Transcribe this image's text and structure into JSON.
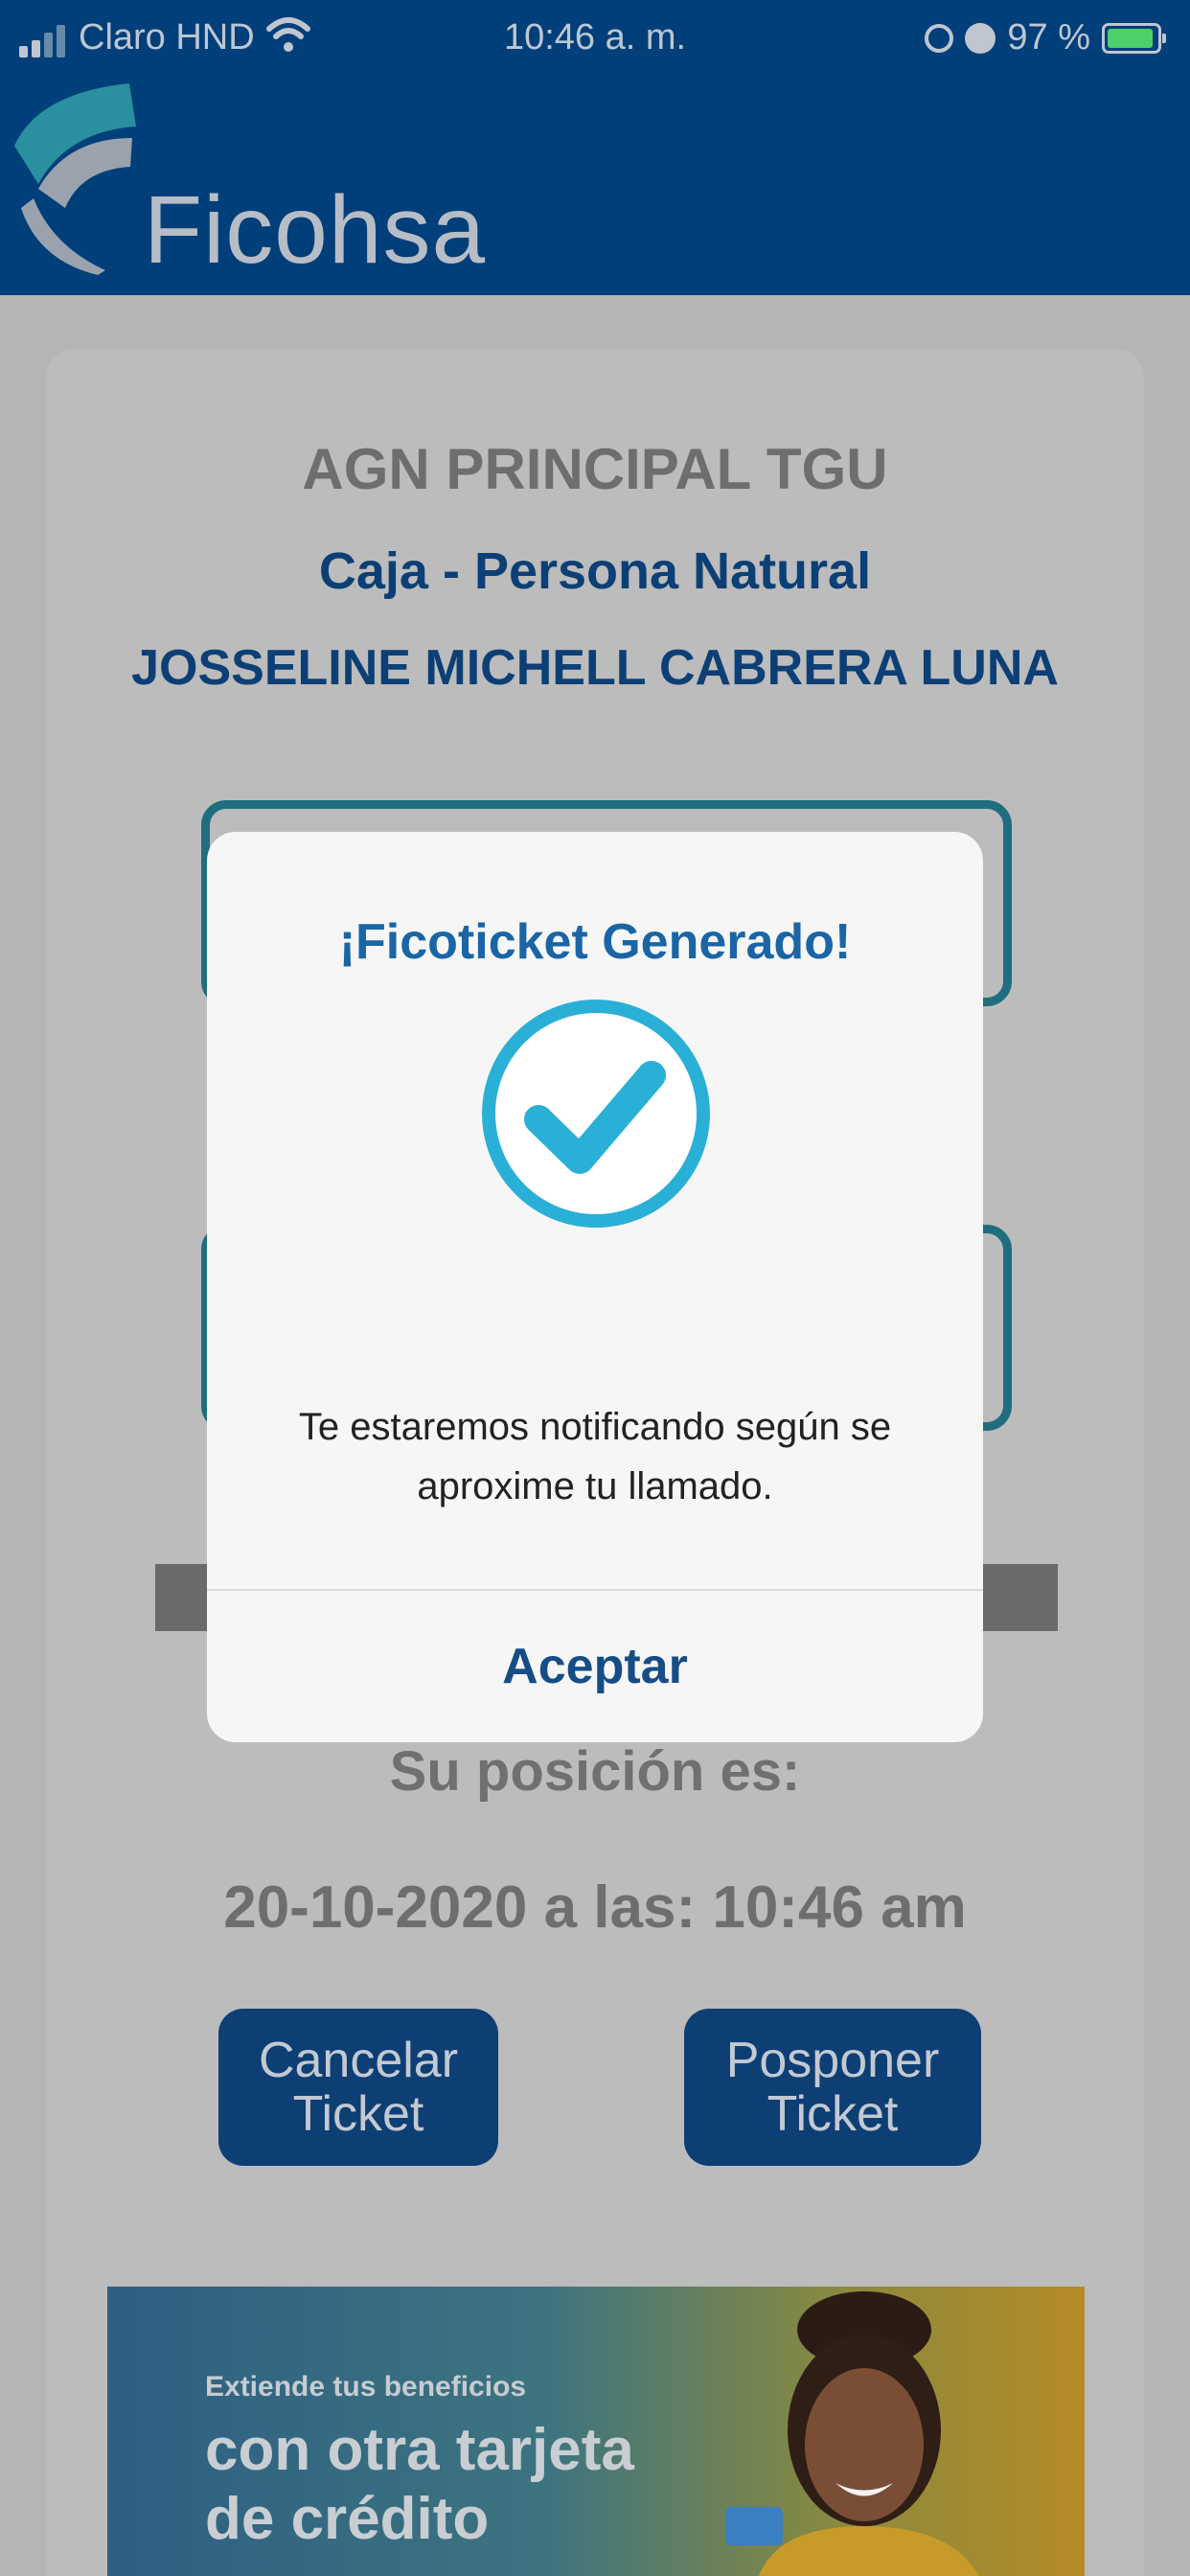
{
  "status_bar": {
    "carrier": "Claro HND",
    "time": "10:46 a. m.",
    "battery": "97 %"
  },
  "header": {
    "brand": "Ficohsa"
  },
  "ticket": {
    "branch": "AGN PRINCIPAL TGU",
    "service": "Caja - Persona Natural",
    "customer": "JOSSELINE MICHELL CABRERA LUNA",
    "position_label": "Su posición es:",
    "datetime": "20-10-2020 a las: 10:46 am"
  },
  "actions": {
    "cancel_label": "Cancelar Ticket",
    "postpone_label": "Posponer Ticket"
  },
  "banner": {
    "line_small": "Extiende tus beneficios",
    "line_big_1": "con otra tarjeta",
    "line_big_2": "de crédito"
  },
  "dialog": {
    "title": "¡Ficoticket Generado!",
    "message": "Te estaremos notificando según se aproxime tu llamado.",
    "accept_label": "Aceptar"
  },
  "colors": {
    "header_bg": "#003f79",
    "brand_blue": "#0d3f75",
    "check_accent": "#2ab0d6"
  },
  "icons": {
    "check": "check-circle-icon",
    "wifi": "wifi-icon",
    "signal": "signal-icon",
    "battery": "battery-icon",
    "alarm": "alarm-icon",
    "orientation_lock": "orientation-lock-icon"
  }
}
